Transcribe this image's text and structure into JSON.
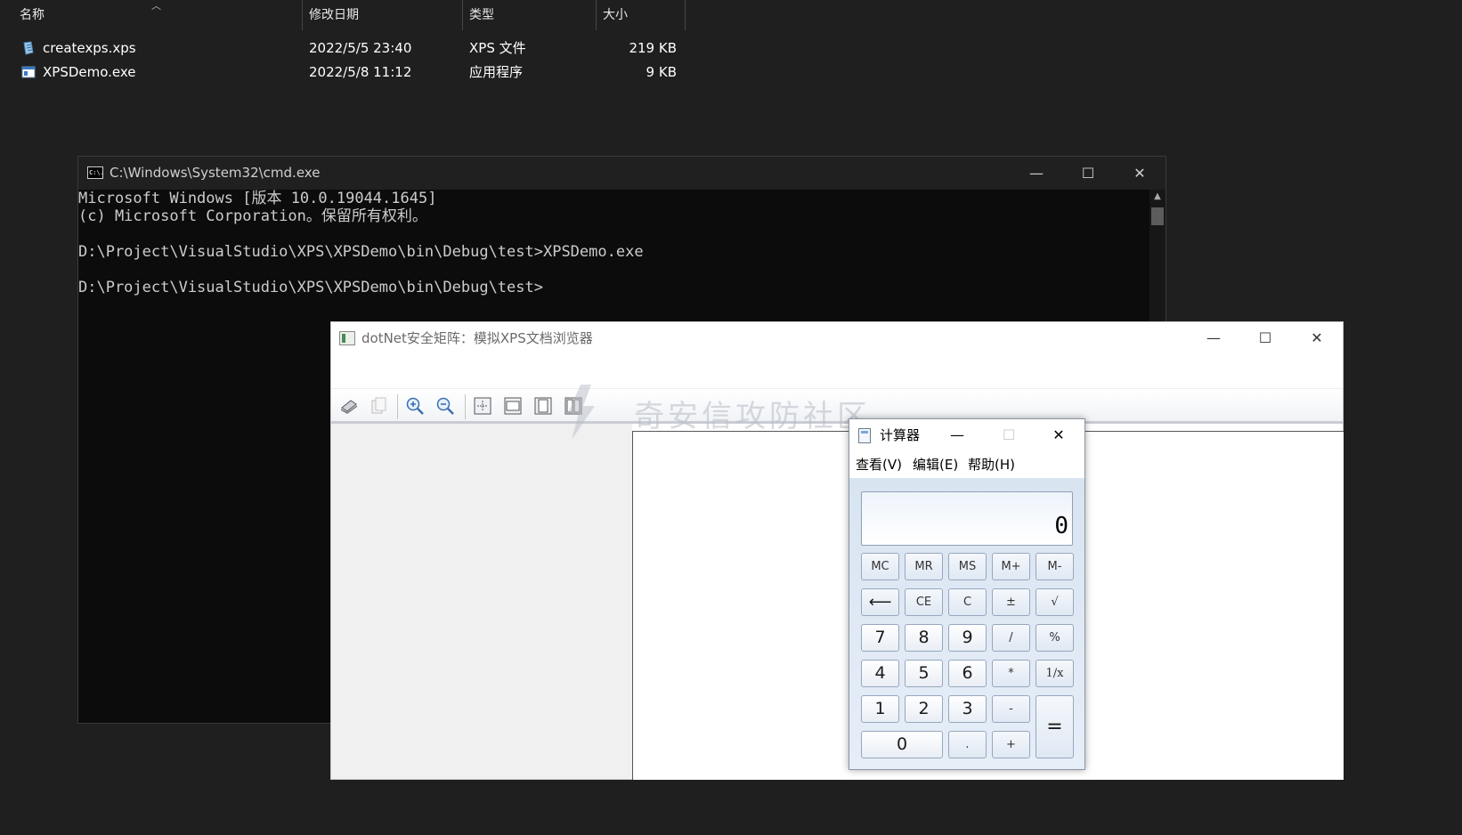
{
  "explorer": {
    "columns": [
      "名称",
      "修改日期",
      "类型",
      "大小"
    ],
    "files": [
      {
        "name": "createxps.xps",
        "date": "2022/5/5 23:40",
        "type": "XPS 文件",
        "size": "219 KB",
        "icon": "xps-file-icon"
      },
      {
        "name": "XPSDemo.exe",
        "date": "2022/5/8 11:12",
        "type": "应用程序",
        "size": "9 KB",
        "icon": "exe-file-icon"
      }
    ]
  },
  "cmd": {
    "title": "C:\\Windows\\System32\\cmd.exe",
    "icon_text": "C:\\.",
    "lines": [
      "Microsoft Windows [版本 10.0.19044.1645]",
      "(c) Microsoft Corporation。保留所有权利。",
      "",
      "D:\\Project\\VisualStudio\\XPS\\XPSDemo\\bin\\Debug\\test>XPSDemo.exe",
      "",
      "D:\\Project\\VisualStudio\\XPS\\XPSDemo\\bin\\Debug\\test>"
    ],
    "window_buttons": {
      "minimize": "—",
      "maximize": "☐",
      "close": "✕"
    }
  },
  "xps_viewer": {
    "title": "dotNet安全矩阵：模拟XPS文档浏览器",
    "window_buttons": {
      "minimize": "—",
      "maximize": "☐",
      "close": "✕"
    },
    "toolbar": [
      "print-icon",
      "copy-icon",
      "zoom-in-icon",
      "zoom-out-icon",
      "actual-size-icon",
      "fit-width-icon",
      "whole-page-icon",
      "two-pages-icon"
    ],
    "watermark": "奇安信攻防社区"
  },
  "calculator": {
    "title": "计算器",
    "window_buttons": {
      "minimize": "—",
      "maximize": "☐",
      "close": "✕"
    },
    "menu": [
      "查看(V)",
      "编辑(E)",
      "帮助(H)"
    ],
    "display": "0",
    "keys": {
      "mc": "MC",
      "mr": "MR",
      "ms": "MS",
      "mplus": "M+",
      "mminus": "M-",
      "back": "⟵",
      "ce": "CE",
      "c": "C",
      "plusminus": "±",
      "sqrt": "√",
      "k7": "7",
      "k8": "8",
      "k9": "9",
      "div": "/",
      "pct": "%",
      "k4": "4",
      "k5": "5",
      "k6": "6",
      "mul": "*",
      "recip": "1/x",
      "k1": "1",
      "k2": "2",
      "k3": "3",
      "sub": "-",
      "eq": "=",
      "k0": "0",
      "dot": ".",
      "add": "+"
    }
  }
}
